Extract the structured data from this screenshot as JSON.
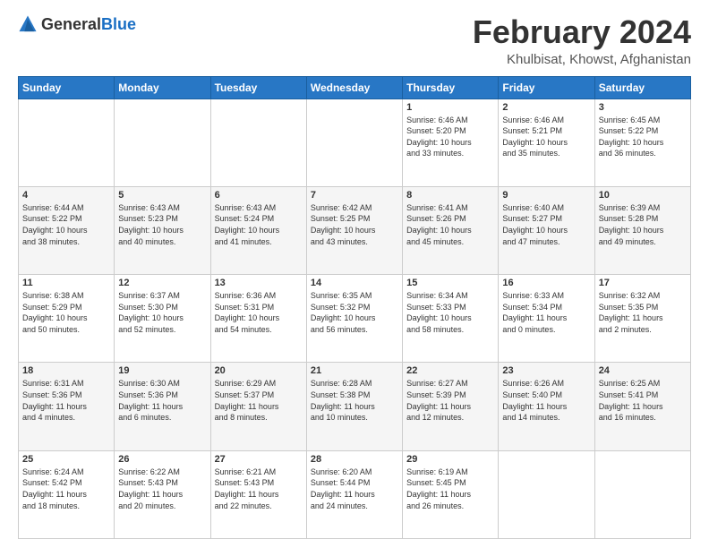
{
  "header": {
    "logo": {
      "general": "General",
      "blue": "Blue"
    },
    "title": "February 2024",
    "location": "Khulbisat, Khowst, Afghanistan"
  },
  "weekdays": [
    "Sunday",
    "Monday",
    "Tuesday",
    "Wednesday",
    "Thursday",
    "Friday",
    "Saturday"
  ],
  "weeks": [
    [
      {
        "day": "",
        "info": ""
      },
      {
        "day": "",
        "info": ""
      },
      {
        "day": "",
        "info": ""
      },
      {
        "day": "",
        "info": ""
      },
      {
        "day": "1",
        "info": "Sunrise: 6:46 AM\nSunset: 5:20 PM\nDaylight: 10 hours\nand 33 minutes."
      },
      {
        "day": "2",
        "info": "Sunrise: 6:46 AM\nSunset: 5:21 PM\nDaylight: 10 hours\nand 35 minutes."
      },
      {
        "day": "3",
        "info": "Sunrise: 6:45 AM\nSunset: 5:22 PM\nDaylight: 10 hours\nand 36 minutes."
      }
    ],
    [
      {
        "day": "4",
        "info": "Sunrise: 6:44 AM\nSunset: 5:22 PM\nDaylight: 10 hours\nand 38 minutes."
      },
      {
        "day": "5",
        "info": "Sunrise: 6:43 AM\nSunset: 5:23 PM\nDaylight: 10 hours\nand 40 minutes."
      },
      {
        "day": "6",
        "info": "Sunrise: 6:43 AM\nSunset: 5:24 PM\nDaylight: 10 hours\nand 41 minutes."
      },
      {
        "day": "7",
        "info": "Sunrise: 6:42 AM\nSunset: 5:25 PM\nDaylight: 10 hours\nand 43 minutes."
      },
      {
        "day": "8",
        "info": "Sunrise: 6:41 AM\nSunset: 5:26 PM\nDaylight: 10 hours\nand 45 minutes."
      },
      {
        "day": "9",
        "info": "Sunrise: 6:40 AM\nSunset: 5:27 PM\nDaylight: 10 hours\nand 47 minutes."
      },
      {
        "day": "10",
        "info": "Sunrise: 6:39 AM\nSunset: 5:28 PM\nDaylight: 10 hours\nand 49 minutes."
      }
    ],
    [
      {
        "day": "11",
        "info": "Sunrise: 6:38 AM\nSunset: 5:29 PM\nDaylight: 10 hours\nand 50 minutes."
      },
      {
        "day": "12",
        "info": "Sunrise: 6:37 AM\nSunset: 5:30 PM\nDaylight: 10 hours\nand 52 minutes."
      },
      {
        "day": "13",
        "info": "Sunrise: 6:36 AM\nSunset: 5:31 PM\nDaylight: 10 hours\nand 54 minutes."
      },
      {
        "day": "14",
        "info": "Sunrise: 6:35 AM\nSunset: 5:32 PM\nDaylight: 10 hours\nand 56 minutes."
      },
      {
        "day": "15",
        "info": "Sunrise: 6:34 AM\nSunset: 5:33 PM\nDaylight: 10 hours\nand 58 minutes."
      },
      {
        "day": "16",
        "info": "Sunrise: 6:33 AM\nSunset: 5:34 PM\nDaylight: 11 hours\nand 0 minutes."
      },
      {
        "day": "17",
        "info": "Sunrise: 6:32 AM\nSunset: 5:35 PM\nDaylight: 11 hours\nand 2 minutes."
      }
    ],
    [
      {
        "day": "18",
        "info": "Sunrise: 6:31 AM\nSunset: 5:36 PM\nDaylight: 11 hours\nand 4 minutes."
      },
      {
        "day": "19",
        "info": "Sunrise: 6:30 AM\nSunset: 5:36 PM\nDaylight: 11 hours\nand 6 minutes."
      },
      {
        "day": "20",
        "info": "Sunrise: 6:29 AM\nSunset: 5:37 PM\nDaylight: 11 hours\nand 8 minutes."
      },
      {
        "day": "21",
        "info": "Sunrise: 6:28 AM\nSunset: 5:38 PM\nDaylight: 11 hours\nand 10 minutes."
      },
      {
        "day": "22",
        "info": "Sunrise: 6:27 AM\nSunset: 5:39 PM\nDaylight: 11 hours\nand 12 minutes."
      },
      {
        "day": "23",
        "info": "Sunrise: 6:26 AM\nSunset: 5:40 PM\nDaylight: 11 hours\nand 14 minutes."
      },
      {
        "day": "24",
        "info": "Sunrise: 6:25 AM\nSunset: 5:41 PM\nDaylight: 11 hours\nand 16 minutes."
      }
    ],
    [
      {
        "day": "25",
        "info": "Sunrise: 6:24 AM\nSunset: 5:42 PM\nDaylight: 11 hours\nand 18 minutes."
      },
      {
        "day": "26",
        "info": "Sunrise: 6:22 AM\nSunset: 5:43 PM\nDaylight: 11 hours\nand 20 minutes."
      },
      {
        "day": "27",
        "info": "Sunrise: 6:21 AM\nSunset: 5:43 PM\nDaylight: 11 hours\nand 22 minutes."
      },
      {
        "day": "28",
        "info": "Sunrise: 6:20 AM\nSunset: 5:44 PM\nDaylight: 11 hours\nand 24 minutes."
      },
      {
        "day": "29",
        "info": "Sunrise: 6:19 AM\nSunset: 5:45 PM\nDaylight: 11 hours\nand 26 minutes."
      },
      {
        "day": "",
        "info": ""
      },
      {
        "day": "",
        "info": ""
      }
    ]
  ]
}
